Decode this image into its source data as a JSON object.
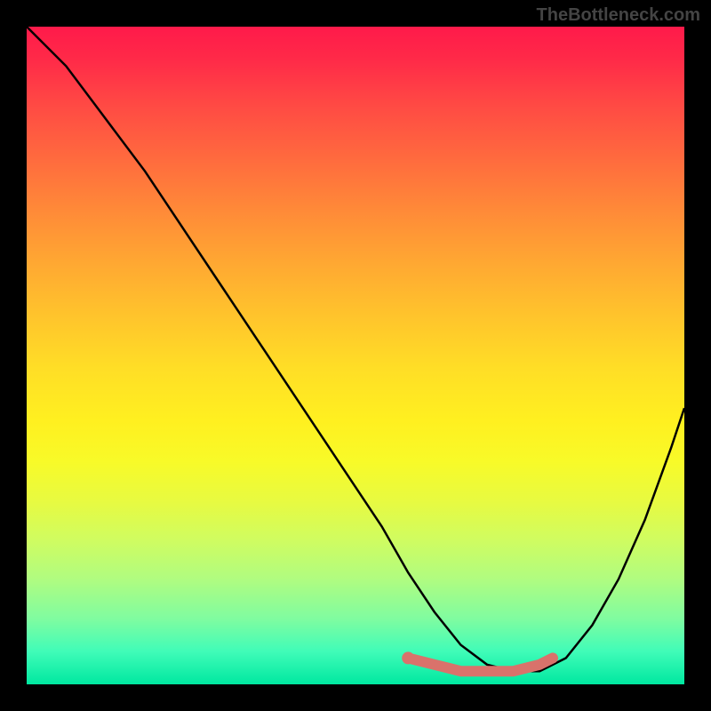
{
  "watermark": "TheBottleneck.com",
  "chart_data": {
    "type": "line",
    "title": "",
    "xlabel": "",
    "ylabel": "",
    "xlim": [
      0,
      100
    ],
    "ylim": [
      0,
      100
    ],
    "series": [
      {
        "name": "bottleneck-curve",
        "x": [
          0,
          6,
          12,
          18,
          24,
          30,
          36,
          42,
          48,
          54,
          58,
          62,
          66,
          70,
          74,
          78,
          82,
          86,
          90,
          94,
          98,
          100
        ],
        "values": [
          100,
          94,
          86,
          78,
          69,
          60,
          51,
          42,
          33,
          24,
          17,
          11,
          6,
          3,
          2,
          2,
          4,
          9,
          16,
          25,
          36,
          42
        ]
      }
    ],
    "highlight_segment": {
      "name": "optimal-range",
      "x": [
        58,
        62,
        66,
        70,
        74,
        78,
        80
      ],
      "values": [
        4,
        3,
        2,
        2,
        2,
        3,
        4
      ]
    },
    "highlight_point": {
      "x": 58,
      "y": 4
    }
  },
  "colors": {
    "curve": "#000000",
    "highlight": "#d9726b",
    "background_top": "#ff1a4a",
    "background_bottom": "#00e8a0"
  }
}
